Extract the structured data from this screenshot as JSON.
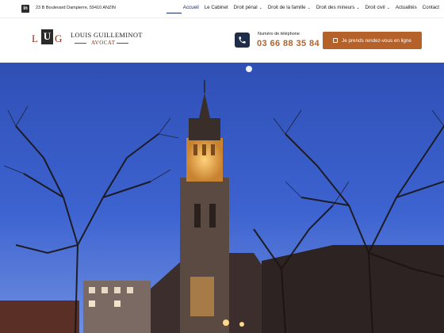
{
  "topbar": {
    "linkedin_icon_text": "in",
    "address": "23 B Boulevard Dampierre, 59410 ANZIN"
  },
  "nav": {
    "items": [
      {
        "label": "Accueil",
        "dropdown": false,
        "active": true
      },
      {
        "label": "Le Cabinet",
        "dropdown": false,
        "active": false
      },
      {
        "label": "Droit pénal",
        "dropdown": true,
        "active": false
      },
      {
        "label": "Droit de la famille",
        "dropdown": true,
        "active": false
      },
      {
        "label": "Droit des mineurs",
        "dropdown": true,
        "active": false
      },
      {
        "label": "Droit civil",
        "dropdown": true,
        "active": false
      },
      {
        "label": "Actualités",
        "dropdown": false,
        "active": false
      },
      {
        "label": "Contact",
        "dropdown": false,
        "active": false
      }
    ]
  },
  "logo": {
    "letter_l": "L",
    "letter_u": "U",
    "letter_g": "G",
    "name": "LOUIS GUILLEMINOT",
    "title": "AVOCAT"
  },
  "contact": {
    "phone_label": "Numéro de téléphone",
    "phone_number": "03 66 88 35 84"
  },
  "cta": {
    "label": "Je prends rendez-vous en ligne"
  },
  "colors": {
    "accent": "#b5612a",
    "dark_navy": "#1f2d48",
    "logo_red": "#8a2b12",
    "nav_active": "#1a2a6c"
  },
  "hero": {
    "image_description_icon": "church-night-photo"
  }
}
